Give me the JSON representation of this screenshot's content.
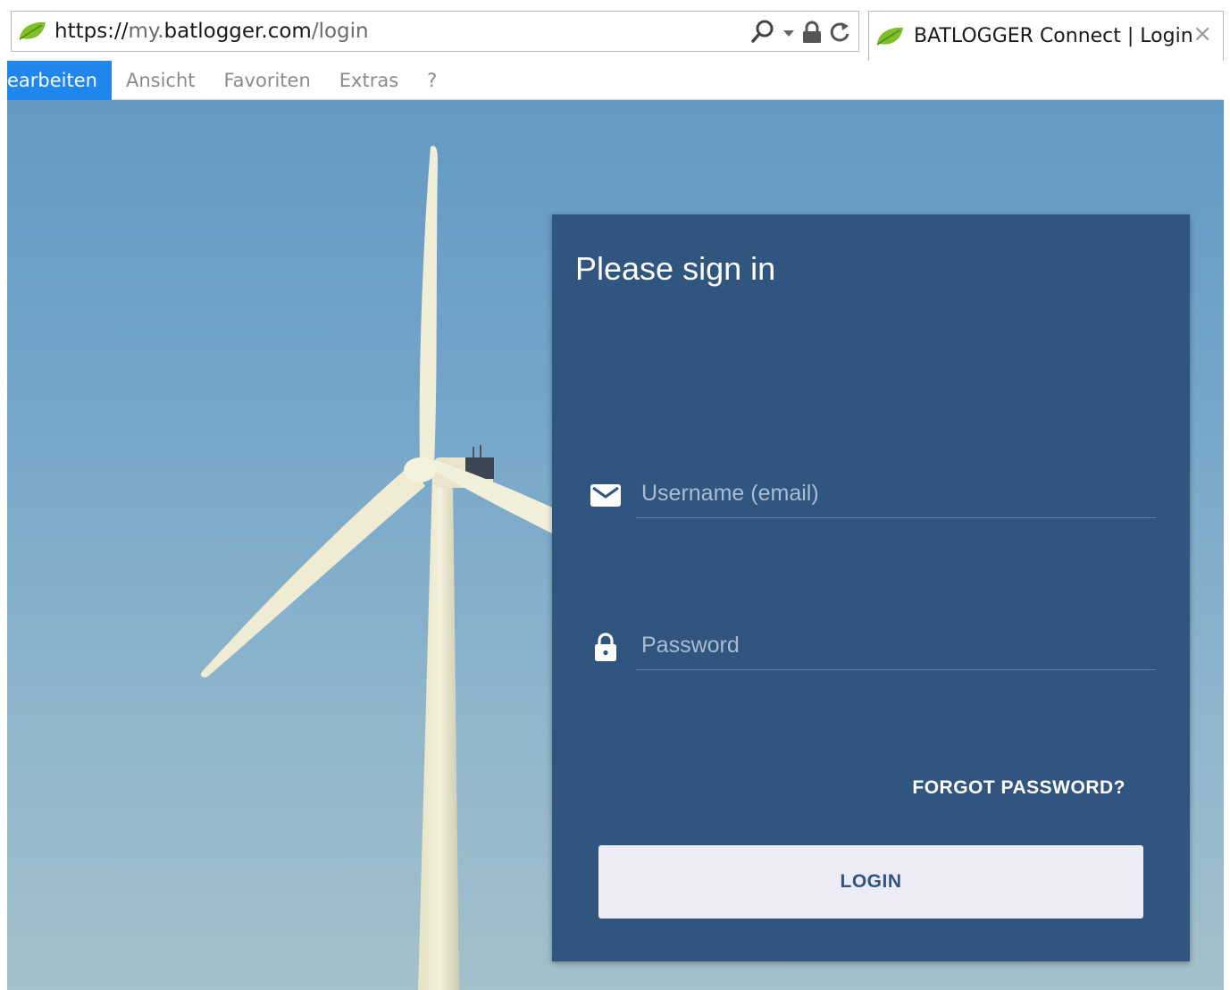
{
  "browser": {
    "url": {
      "scheme": "https://",
      "subdomain": "my.",
      "host": "batlogger.com",
      "path": "/login"
    },
    "tab": {
      "title": "BATLOGGER Connect | Login",
      "close": "×"
    },
    "menu": [
      "earbeiten",
      "Ansicht",
      "Favoriten",
      "Extras",
      "?"
    ],
    "colors": {
      "menu_active": "#1f86ee",
      "favicon": "#7fbf2a"
    }
  },
  "login": {
    "title": "Please sign in",
    "username_placeholder": "Username (email)",
    "password_placeholder": "Password",
    "forgot_label": "FORGOT PASSWORD?",
    "login_label": "LOGIN",
    "icons": {
      "username": "envelope-icon",
      "password": "lock-icon"
    },
    "colors": {
      "card": "#30557f",
      "button": "#ecebf6"
    }
  }
}
